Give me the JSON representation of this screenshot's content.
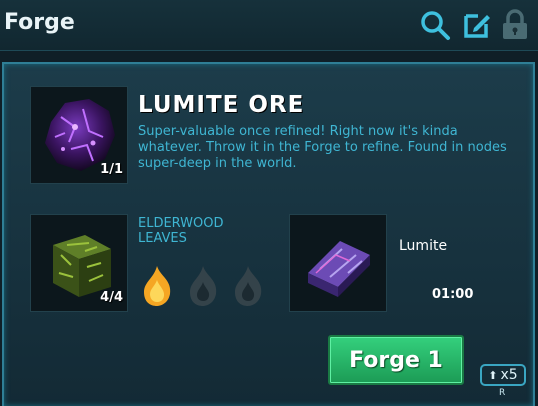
{
  "window": {
    "title": "Forge"
  },
  "header_icons": [
    {
      "name": "search-icon"
    },
    {
      "name": "edit-icon"
    },
    {
      "name": "lock-icon"
    }
  ],
  "item": {
    "name": "LUMITE ORE",
    "description": "Super-valuable once refined! Right now it's kinda whatever. Throw it in the Forge to refine. Found in nodes super-deep in the world.",
    "quantity": "1/1"
  },
  "ingredient": {
    "name": "ELDERWOOD LEAVES",
    "quantity": "4/4"
  },
  "fuel": {
    "filled": 1,
    "total": 3
  },
  "output": {
    "name": "Lumite",
    "time": "01:00"
  },
  "buttons": {
    "forge_label": "Forge 1",
    "multiplier_label": "x5",
    "multiplier_key": "R"
  },
  "colors": {
    "accent": "#3fb6d3",
    "button": "#2bbd6a",
    "panel_border": "#2f7f96"
  }
}
